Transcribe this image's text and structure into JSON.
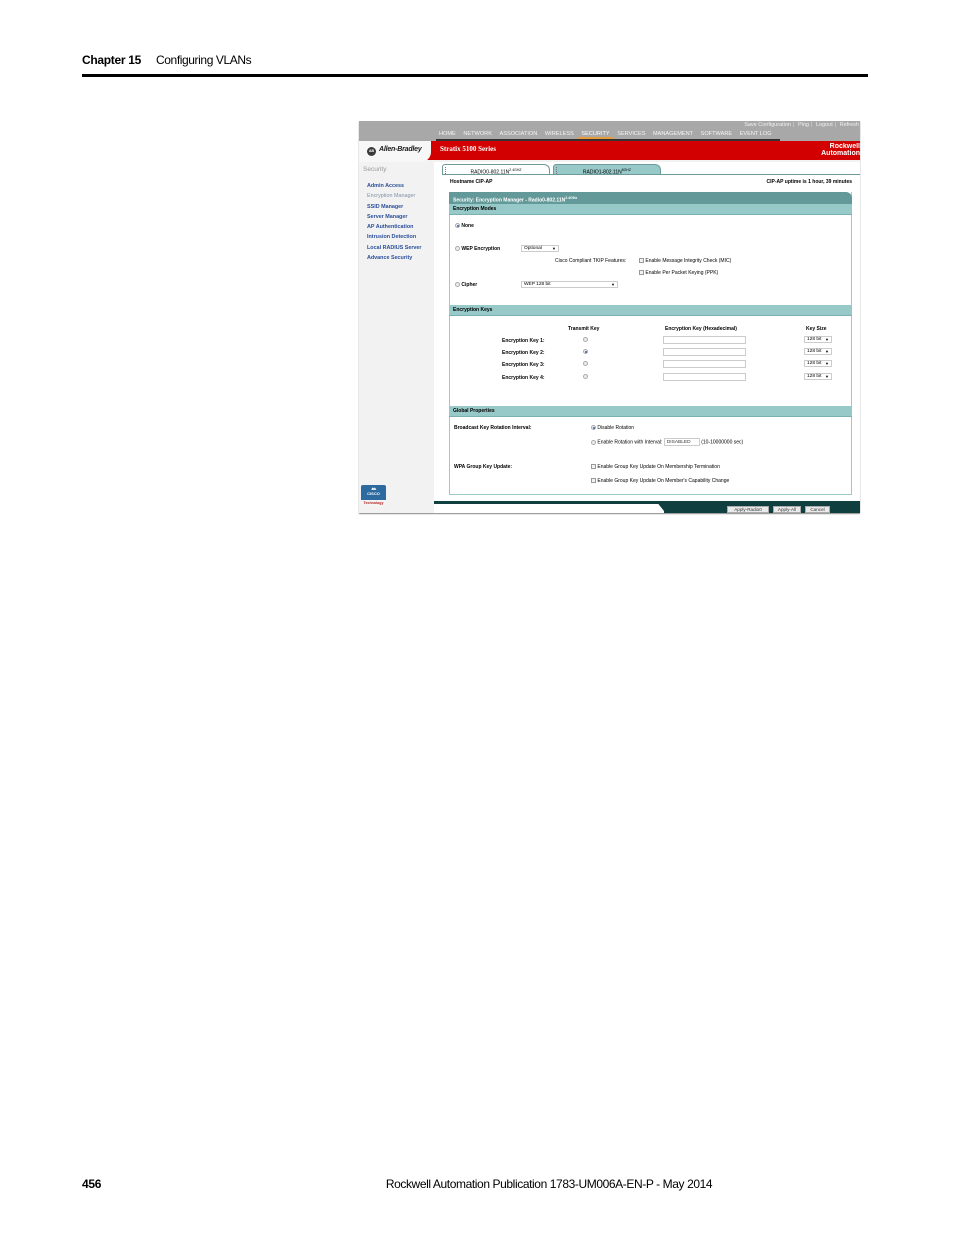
{
  "page": {
    "chapter_label": "Chapter 15",
    "chapter_title": "Configuring VLANs",
    "page_number": "456",
    "publication": "Rockwell Automation Publication 1783-UM006A-EN-P - May 2014"
  },
  "screenshot": {
    "utility_links": [
      "Save Configuration",
      "Ping",
      "Logout",
      "Refresh"
    ],
    "nav": {
      "items": [
        "HOME",
        "NETWORK",
        "ASSOCIATION",
        "WIRELESS",
        "SECURITY",
        "SERVICES",
        "MANAGEMENT",
        "SOFTWARE",
        "EVENT LOG"
      ],
      "active": "SECURITY"
    },
    "brand": {
      "logo_badge": "AB",
      "logo_text": "Allen-Bradley",
      "product_title": "Stratix 5100 Series",
      "corner_brand_line1": "Rockwell",
      "corner_brand_line2": "Automation",
      "colors": {
        "header_red": "#d20000",
        "nav_gray": "#a8a8a8",
        "active_underline": "#e89b3a",
        "panel_title": "#649999",
        "section_head": "#97c9c9",
        "link_blue": "#2a4f9a"
      }
    },
    "sidebar": {
      "title": "Security",
      "items": [
        {
          "label": "Admin Access",
          "current": false
        },
        {
          "label": "Encryption Manager",
          "current": true
        },
        {
          "label": "SSID Manager",
          "current": false
        },
        {
          "label": "Server Manager",
          "current": false
        },
        {
          "label": "AP Authentication",
          "current": false
        },
        {
          "label": "Intrusion Detection",
          "current": false
        },
        {
          "label": "Local RADIUS Server",
          "current": false
        },
        {
          "label": "Advance Security",
          "current": false
        }
      ],
      "footer_logo_top": "CISCO",
      "footer_logo_bottom": "Technology"
    },
    "tabs": [
      {
        "label": "RADIO0-802.11N",
        "sup": "2.4GHZ",
        "active": true
      },
      {
        "label": "RADIO1-802.11N",
        "sup": "5GHZ",
        "active": false
      }
    ],
    "hostname_label": "Hostname  CIP-AP",
    "uptime": "CIP-AP uptime is 1 hour, 39 minutes",
    "panel_title": "Security: Encryption Manager - Radio0-802.11N",
    "panel_title_sup": "2.4GHz",
    "encryption_modes": {
      "heading": "Encryption Modes",
      "none_label": "None",
      "none_selected": true,
      "wep_label": "WEP Encryption",
      "wep_select": "Optional",
      "tkip_label": "Cisco Compliant TKIP Features:",
      "mic_label": "Enable Message Integrity Check (MIC)",
      "ppk_label": "Enable Per Packet Keying (PPK)",
      "cipher_label": "Cipher",
      "cipher_select": "WEP 128 bit"
    },
    "encryption_keys": {
      "heading": "Encryption Keys",
      "col_transmit": "Transmit Key",
      "col_key": "Encryption Key (Hexadecimal)",
      "col_size": "Key Size",
      "rows": [
        {
          "label": "Encryption Key 1:",
          "transmit": false,
          "value": "",
          "size": "128 bit"
        },
        {
          "label": "Encryption Key 2:",
          "transmit": true,
          "value": "",
          "size": "128 bit"
        },
        {
          "label": "Encryption Key 3:",
          "transmit": false,
          "value": "",
          "size": "128 bit"
        },
        {
          "label": "Encryption Key 4:",
          "transmit": false,
          "value": "",
          "size": "128 bit"
        }
      ]
    },
    "global_properties": {
      "heading": "Global Properties",
      "broadcast_label": "Broadcast Key Rotation Interval:",
      "disable_rotation": "Disable Rotation",
      "enable_rotation": "Enable Rotation with Interval:",
      "interval_value": "DISABLED",
      "interval_hint": "(10-10000000 sec)",
      "wpa_label": "WPA Group Key Update:",
      "membership_termination": "Enable Group Key Update On Membership Termination",
      "capability_change": "Enable Group Key Update On Member's Capability Change"
    },
    "buttons": {
      "apply_radio": "Apply-Radio0",
      "apply_all": "Apply-All",
      "cancel": "Cancel"
    }
  }
}
